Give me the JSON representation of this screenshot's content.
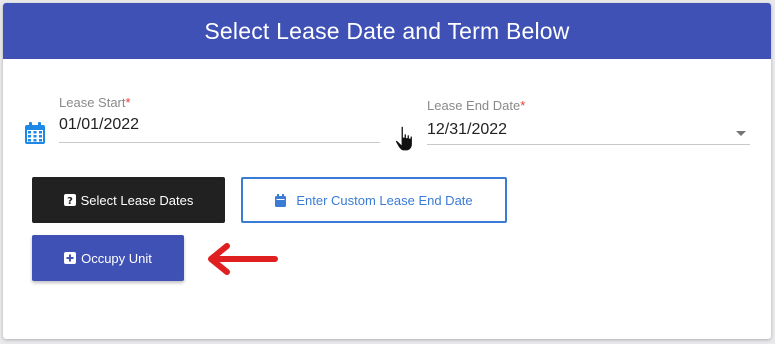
{
  "header": {
    "title": "Select Lease Date and Term Below"
  },
  "lease_start": {
    "label": "Lease Start",
    "required_mark": "*",
    "value": "01/01/2022"
  },
  "lease_end": {
    "label": "Lease End Date",
    "required_mark": "*",
    "value": "12/31/2022"
  },
  "buttons": {
    "select_dates": "Select Lease Dates",
    "custom_end_date": "Enter Custom Lease End Date",
    "occupy_unit": "Occupy Unit"
  },
  "colors": {
    "header_bg": "#3f51b5",
    "primary": "#3f51b5",
    "dark_button": "#212121",
    "outline_blue": "#3a7bd5",
    "required": "#e53935",
    "annotation_arrow": "#e02020"
  },
  "icons": {
    "lease_start": "calendar-icon",
    "cursor": "hand-pointer-icon",
    "select_dates": "question-square-icon",
    "custom_end_date": "calendar-icon",
    "occupy_unit": "plus-square-icon",
    "annotation": "left-arrow-icon"
  }
}
